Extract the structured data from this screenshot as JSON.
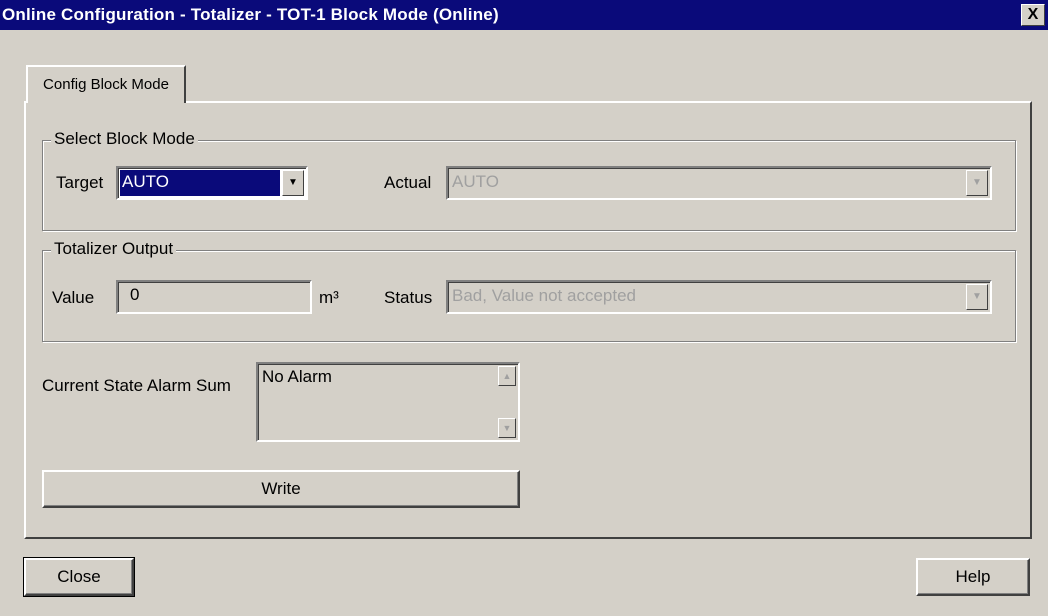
{
  "window": {
    "title": "Online Configuration - Totalizer - TOT-1 Block Mode  (Online)",
    "close_glyph": "X"
  },
  "tabs": [
    {
      "label": "Config Block Mode",
      "selected": true
    }
  ],
  "select_block_mode": {
    "legend": "Select Block Mode",
    "target_label": "Target",
    "target_value": "AUTO",
    "actual_label": "Actual",
    "actual_value": "AUTO"
  },
  "totalizer_output": {
    "legend": "Totalizer Output",
    "value_label": "Value",
    "value": "0",
    "unit": "m³",
    "status_label": "Status",
    "status_value": "Bad, Value not accepted"
  },
  "alarm": {
    "label": "Current State Alarm Sum",
    "value": "No Alarm"
  },
  "buttons": {
    "write": "Write",
    "close": "Close",
    "help": "Help"
  },
  "icons": {
    "dropdown": "▼",
    "scroll_up": "▲",
    "scroll_down": "▼"
  },
  "colors": {
    "titlebar": "#0a0a7a",
    "face": "#d4d0c8",
    "selection": "#0a0a7a",
    "disabled_text": "#a0a0a0"
  }
}
